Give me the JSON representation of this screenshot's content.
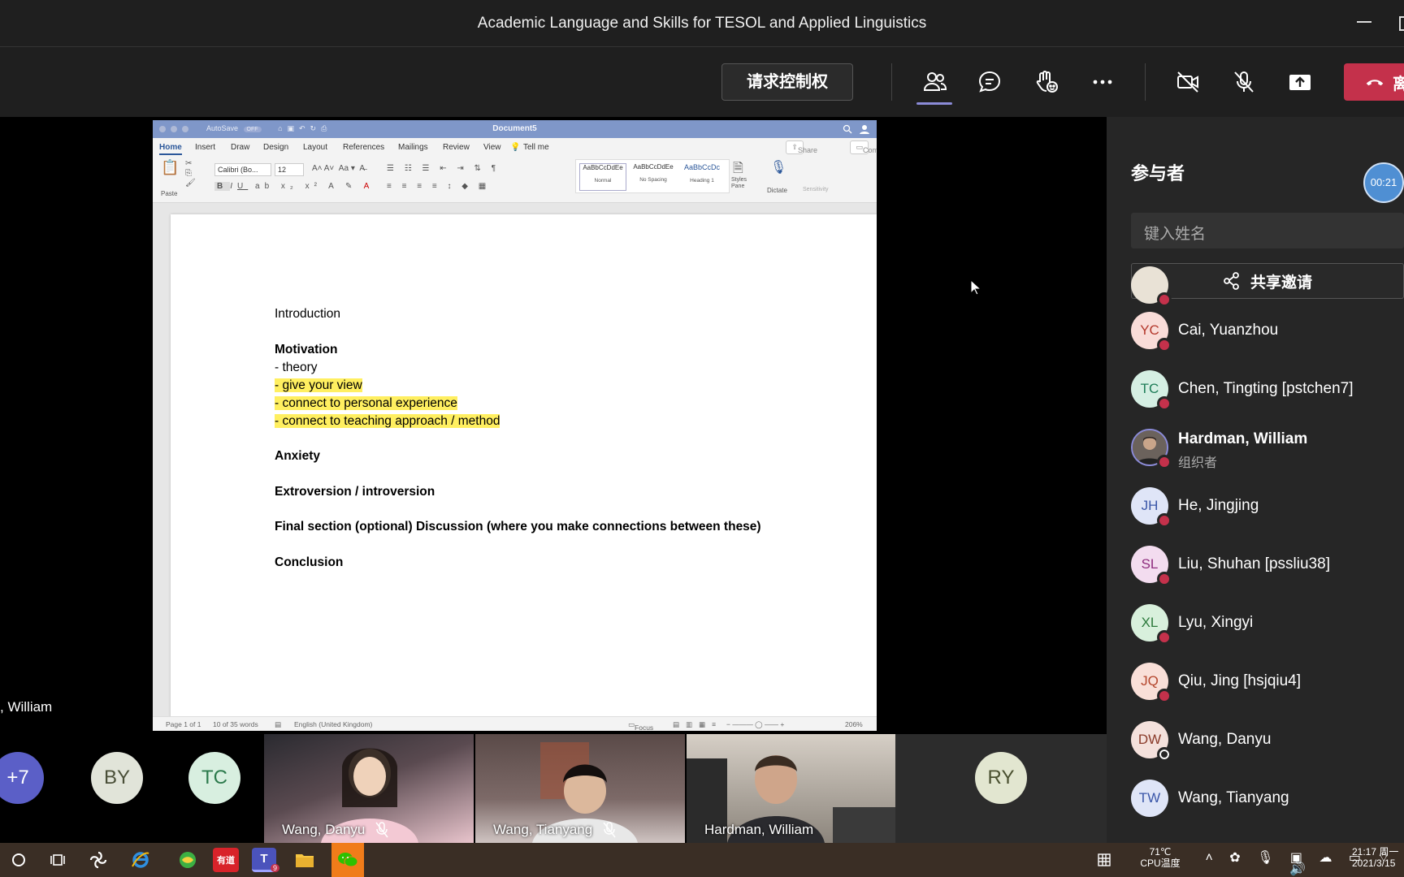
{
  "window": {
    "title": "Academic Language and Skills for TESOL and Applied Linguistics"
  },
  "toolbar": {
    "request_control_label": "请求控制权",
    "icons": [
      "people-icon",
      "chat-icon",
      "raise-hand-icon",
      "more-icon",
      "camera-off-icon",
      "mic-off-icon",
      "share-tray-icon",
      "leave-call-icon"
    ],
    "leave_label_partial": "离",
    "accent": "#c4314b"
  },
  "stage": {
    "presenter_name_partial": ", William"
  },
  "word": {
    "autosave_label": "AutoSave",
    "autosave_state": "OFF",
    "document_name": "Document5",
    "tabs": [
      "Home",
      "Insert",
      "Draw",
      "Design",
      "Layout",
      "References",
      "Mailings",
      "Review",
      "View",
      "Tell me"
    ],
    "share_label": "Share",
    "comments_label": "Comments",
    "ribbon": {
      "paste_label": "Paste",
      "font_name": "Calibri (Bo...",
      "font_size": "12",
      "styles": [
        {
          "sample": "AaBbCcDdEe",
          "name": "Normal"
        },
        {
          "sample": "AaBbCcDdEe",
          "name": "No Spacing"
        },
        {
          "sample": "AaBbCcDc",
          "name": "Heading 1"
        }
      ],
      "styles_pane_label": "Styles Pane",
      "dictate_label": "Dictate",
      "sensitivity_label": "Sensitivity"
    },
    "status": {
      "page": "Page 1 of 1",
      "words": "10 of 35 words",
      "language": "English (United Kingdom)",
      "focus": "Focus",
      "zoom": "206%"
    },
    "content": {
      "introduction": "Introduction",
      "motivation": "Motivation",
      "theory": "- theory",
      "give_view": "- give your view",
      "personal": "- connect to personal experience",
      "teaching": "- connect to teaching approach / method",
      "anxiety": "Anxiety",
      "extroversion": "Extroversion / introversion",
      "final_section": "Final section (optional) Discussion (where you make connections between these)",
      "conclusion": "Conclusion"
    }
  },
  "panel": {
    "title": "参与者",
    "timer": "00:21",
    "search_placeholder": "键入姓名",
    "share_invite_label": "共享邀请",
    "participants": [
      {
        "initials": "",
        "name": "",
        "status": "busy"
      },
      {
        "initials": "YC",
        "name": "Cai, Yuanzhou",
        "status": "busy"
      },
      {
        "initials": "TC",
        "name": "Chen, Tingting [pstchen7]",
        "status": "busy"
      },
      {
        "initials": "",
        "name": "Hardman, William",
        "role": "组织者",
        "status": "dnd"
      },
      {
        "initials": "JH",
        "name": "He, Jingjing",
        "status": "busy"
      },
      {
        "initials": "SL",
        "name": "Liu, Shuhan [pssliu38]",
        "status": "busy"
      },
      {
        "initials": "XL",
        "name": "Lyu, Xingyi",
        "status": "busy"
      },
      {
        "initials": "JQ",
        "name": "Qiu, Jing [hsjqiu4]",
        "status": "busy"
      },
      {
        "initials": "DW",
        "name": "Wang, Danyu",
        "status": "offline"
      },
      {
        "initials": "TW",
        "name": "Wang, Tianyang",
        "status": "busy"
      }
    ]
  },
  "gallery": {
    "overflow": "+7",
    "circles": [
      "BY",
      "TC"
    ],
    "videos": [
      "Wang, Danyu",
      "Wang, Tianyang",
      "Hardman, William"
    ],
    "tile_initials": "RY"
  },
  "taskbar": {
    "temperature": "71℃",
    "temp_label": "CPU温度",
    "time": "21:17 周一",
    "date": "2021/3/15",
    "teams_badge": "9",
    "youdao_label": "有道"
  }
}
